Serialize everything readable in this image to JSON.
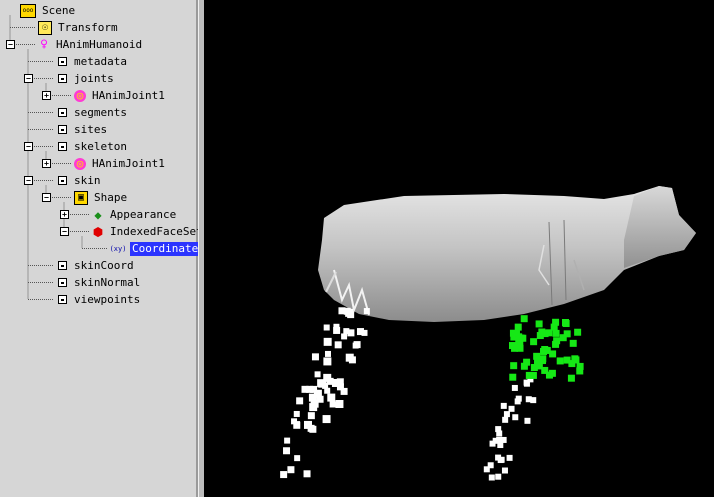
{
  "scene_tree": {
    "nodes": [
      {
        "label": "Scene",
        "depth": 0,
        "icon": "scene-icon"
      },
      {
        "label": "Transform",
        "depth": 1,
        "icon": "transform-icon"
      },
      {
        "label": "HAnimHumanoid",
        "depth": 1,
        "icon": "humanoid-icon",
        "expander": "minus"
      },
      {
        "label": "metadata",
        "depth": 2,
        "icon": "field-icon"
      },
      {
        "label": "joints",
        "depth": 2,
        "icon": "field-icon",
        "expander": "minus"
      },
      {
        "label": "HAnimJoint1",
        "depth": 3,
        "icon": "joint-icon",
        "expander": "plus"
      },
      {
        "label": "segments",
        "depth": 2,
        "icon": "field-icon"
      },
      {
        "label": "sites",
        "depth": 2,
        "icon": "field-icon"
      },
      {
        "label": "skeleton",
        "depth": 2,
        "icon": "field-icon",
        "expander": "minus"
      },
      {
        "label": "HAnimJoint1",
        "depth": 3,
        "icon": "joint-icon",
        "expander": "plus"
      },
      {
        "label": "skin",
        "depth": 2,
        "icon": "field-icon",
        "expander": "minus"
      },
      {
        "label": "Shape",
        "depth": 3,
        "icon": "shape-icon",
        "expander": "minus"
      },
      {
        "label": "Appearance",
        "depth": 4,
        "icon": "appearance-icon",
        "expander": "plus"
      },
      {
        "label": "IndexedFaceSet",
        "depth": 4,
        "icon": "faceset-icon",
        "expander": "minus"
      },
      {
        "label": "Coordinate",
        "depth": 5,
        "icon": "coordinate-icon",
        "selected": true
      },
      {
        "label": "skinCoord",
        "depth": 2,
        "icon": "field-icon"
      },
      {
        "label": "skinNormal",
        "depth": 2,
        "icon": "field-icon"
      },
      {
        "label": "viewpoints",
        "depth": 2,
        "icon": "field-icon"
      }
    ]
  },
  "colors": {
    "tree_bg": "#d6d6d6",
    "selection": "#2b34ff",
    "viewport_bg": "#000000",
    "body_fill": "#c4c4c4",
    "selected_points": "#16e816",
    "points": "#ffffff"
  },
  "icon_glyphs": {
    "scene-icon": "ooo",
    "transform-icon": "☉",
    "humanoid-icon": "♀",
    "joint-icon": "◎",
    "shape-icon": "▣",
    "appearance-icon": "◆",
    "faceset-icon": "⬢",
    "coordinate-icon": "(xy)"
  }
}
